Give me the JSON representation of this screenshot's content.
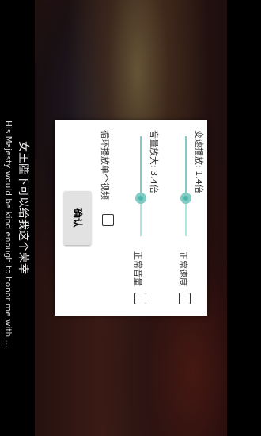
{
  "video": {
    "subtitle_cn": "女王陛下可以给我这个荣幸",
    "subtitle_en": "His Majesty would be kind enough to honor me with ..."
  },
  "dialog": {
    "speed": {
      "label": "变速播放: 1.4倍",
      "value_fraction": 0.55,
      "checkbox_label": "正常速度",
      "checked": false
    },
    "volume": {
      "label": "音量放大: 3.4倍",
      "value_fraction": 0.53,
      "checkbox_label": "正常音量",
      "checked": false
    },
    "loop": {
      "label": "循环播放单个视频",
      "checked": false
    },
    "confirm_label": "确认"
  },
  "colors": {
    "accent": "#80cbc4",
    "track": "#aee5df",
    "dialog_bg": "#ffffff"
  }
}
